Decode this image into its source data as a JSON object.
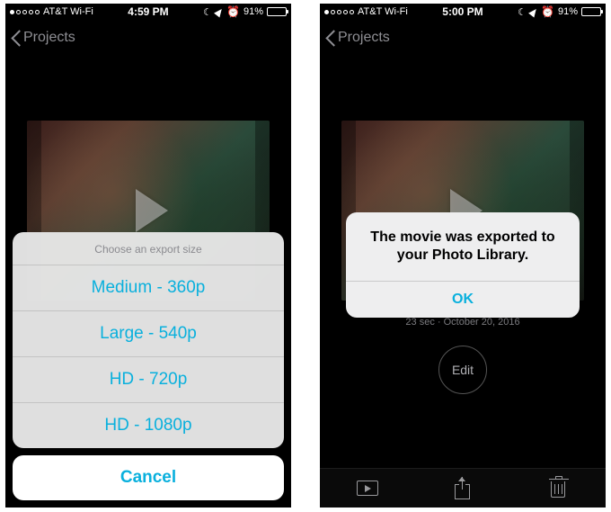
{
  "left": {
    "status": {
      "carrier": "AT&T Wi-Fi",
      "time": "4:59 PM",
      "battery_pct": "91%"
    },
    "nav": {
      "back_label": "Projects"
    },
    "sheet": {
      "title": "Choose an export size",
      "options": [
        "Medium - 360p",
        "Large - 540p",
        "HD - 720p",
        "HD - 1080p"
      ],
      "cancel": "Cancel"
    }
  },
  "right": {
    "status": {
      "carrier": "AT&T Wi-Fi",
      "time": "5:00 PM",
      "battery_pct": "91%"
    },
    "nav": {
      "back_label": "Projects"
    },
    "alert": {
      "message": "The movie was exported to your Photo Library.",
      "ok": "OK"
    },
    "meta": "23 sec · October 20, 2016",
    "edit": "Edit"
  }
}
